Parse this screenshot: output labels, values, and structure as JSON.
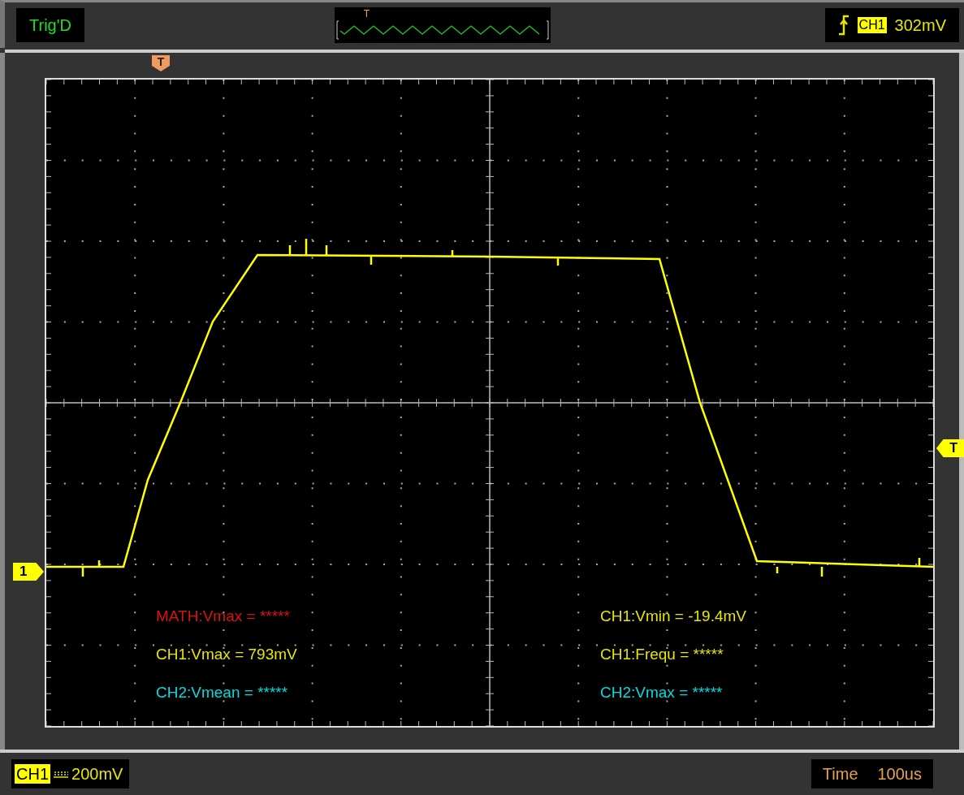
{
  "top_bar": {
    "status": "Trig'D",
    "overview": {
      "trigger_mark": "T"
    },
    "trigger": {
      "channel": "CH1",
      "level": "302mV"
    }
  },
  "plot": {
    "trigger_position_marker": "T",
    "channel_marker": "1",
    "trigger_level_marker": "T",
    "measurements": [
      {
        "text": "MATH:Vmax = *****",
        "color": "#dd1111"
      },
      {
        "text": "CH1:Vmin = -19.4mV",
        "color": "#e6e600"
      },
      {
        "text": "CH1:Vmax = 793mV",
        "color": "#e6e600"
      },
      {
        "text": "CH1:Frequ = *****",
        "color": "#e6e600"
      },
      {
        "text": "CH2:Vmean = *****",
        "color": "#00dde0"
      },
      {
        "text": "CH2:Vmax = *****",
        "color": "#00dde0"
      }
    ]
  },
  "bottom_bar": {
    "channel": "CH1",
    "volts_per_div": "200mV",
    "time_label": "Time",
    "time_per_div": "100us"
  }
}
